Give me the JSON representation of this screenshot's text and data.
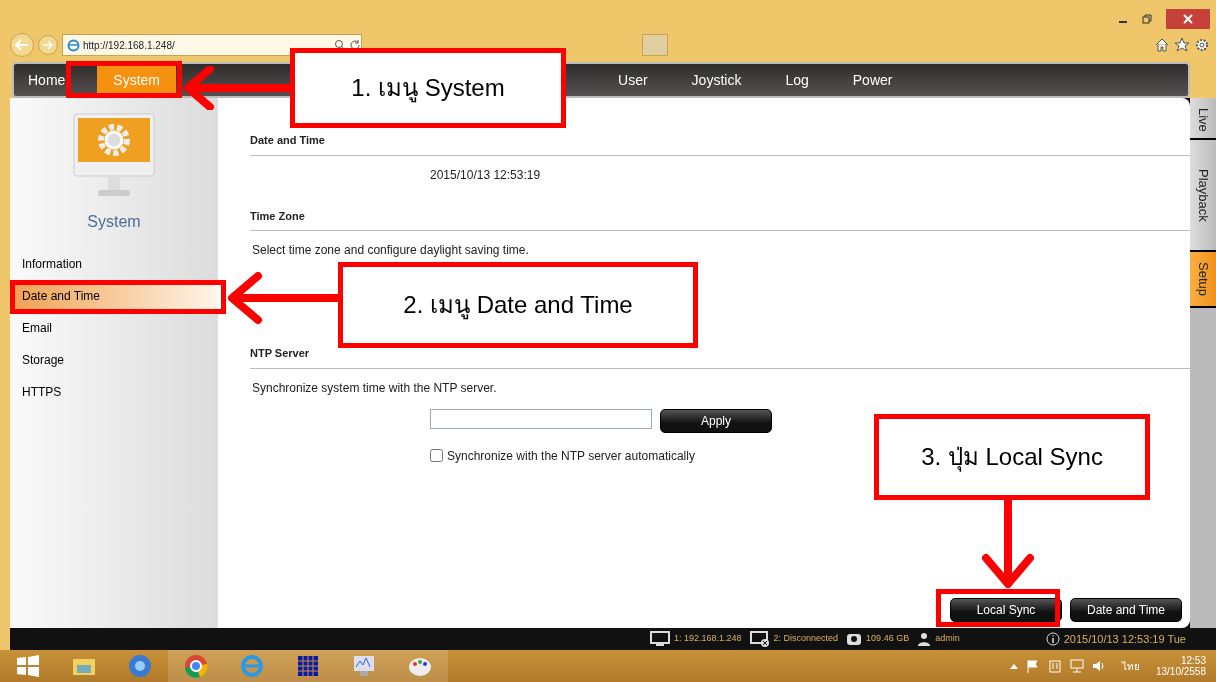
{
  "browser": {
    "address": "http://192.168.1.248/"
  },
  "nav": [
    {
      "label": "Home",
      "selected": false
    },
    {
      "label": "System",
      "selected": true
    },
    {
      "label": "User",
      "selected": false
    },
    {
      "label": "Joystick",
      "selected": false
    },
    {
      "label": "Log",
      "selected": false
    },
    {
      "label": "Power",
      "selected": false
    }
  ],
  "side_tabs": [
    {
      "label": "Live",
      "selected": false
    },
    {
      "label": "Playback",
      "selected": false
    },
    {
      "label": "Setup",
      "selected": true
    }
  ],
  "sidebar": {
    "title": "System",
    "items": [
      {
        "label": "Information",
        "selected": false
      },
      {
        "label": "Date and Time",
        "selected": true
      },
      {
        "label": "Email",
        "selected": false
      },
      {
        "label": "Storage",
        "selected": false
      },
      {
        "label": "HTTPS",
        "selected": false
      }
    ]
  },
  "date_time": {
    "heading": "Date and Time",
    "value": "2015/10/13 12:53:19"
  },
  "time_zone": {
    "heading": "Time Zone",
    "description": "Select time zone and configure daylight saving time."
  },
  "ntp": {
    "heading": "NTP Server",
    "description": "Synchronize system time with the NTP server.",
    "apply": "Apply",
    "auto_sync": {
      "label": "Synchronize with the NTP server automatically",
      "checked": false
    }
  },
  "buttons": [
    "Local Sync",
    "Date and Time"
  ],
  "status_bar": {
    "display_1": "1: 192.168.1.248",
    "display_2": "2: Disconnected",
    "storage": "109.46 GB",
    "user": "admin",
    "datetime": "2015/10/13 12:53:19 Tue"
  },
  "taskbar": {
    "language": "ไทย",
    "time": "12:53",
    "date": "13/10/2558"
  },
  "annotations": [
    "1. เมนู System",
    "2. เมนู Date and Time",
    "3. ปุ่ม Local Sync"
  ]
}
